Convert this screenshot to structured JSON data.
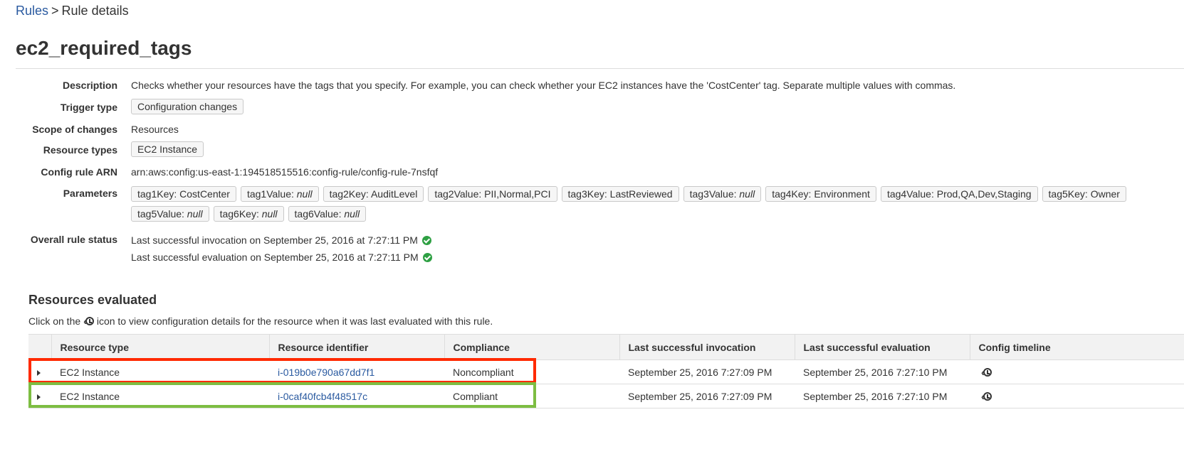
{
  "breadcrumb": {
    "parent": "Rules",
    "separator": ">",
    "current": "Rule details"
  },
  "title": "ec2_required_tags",
  "details": {
    "description": {
      "label": "Description",
      "value": "Checks whether your resources have the tags that you specify. For example, you can check whether your EC2 instances have the 'CostCenter' tag. Separate multiple values with commas."
    },
    "trigger_type": {
      "label": "Trigger type",
      "value": "Configuration changes"
    },
    "scope": {
      "label": "Scope of changes",
      "value": "Resources"
    },
    "resource_types": {
      "label": "Resource types",
      "value": "EC2 Instance"
    },
    "arn": {
      "label": "Config rule ARN",
      "value": "arn:aws:config:us-east-1:194518515516:config-rule/config-rule-7nsfqf"
    },
    "parameters": {
      "label": "Parameters",
      "items": [
        {
          "key": "tag1Key:",
          "value": "CostCenter",
          "null": false
        },
        {
          "key": "tag1Value:",
          "value": "null",
          "null": true
        },
        {
          "key": "tag2Key:",
          "value": "AuditLevel",
          "null": false
        },
        {
          "key": "tag2Value:",
          "value": "PII,Normal,PCI",
          "null": false
        },
        {
          "key": "tag3Key:",
          "value": "LastReviewed",
          "null": false
        },
        {
          "key": "tag3Value:",
          "value": "null",
          "null": true
        },
        {
          "key": "tag4Key:",
          "value": "Environment",
          "null": false
        },
        {
          "key": "tag4Value:",
          "value": "Prod,QA,Dev,Staging",
          "null": false
        },
        {
          "key": "tag5Key:",
          "value": "Owner",
          "null": false
        },
        {
          "key": "tag5Value:",
          "value": "null",
          "null": true
        },
        {
          "key": "tag6Key:",
          "value": "null",
          "null": true
        },
        {
          "key": "tag6Value:",
          "value": "null",
          "null": true
        }
      ]
    },
    "status": {
      "label": "Overall rule status",
      "lines": [
        "Last successful invocation on September 25, 2016 at 7:27:11 PM",
        "Last successful evaluation on September 25, 2016 at 7:27:11 PM"
      ],
      "icon": "check-circle-icon",
      "color": "#2ea043"
    }
  },
  "resources": {
    "title": "Resources evaluated",
    "hint_before": "Click on the",
    "hint_icon": "config-timeline-icon",
    "hint_after": "icon to view configuration details for the resource when it was last evaluated with this rule.",
    "columns": [
      "",
      "Resource type",
      "Resource identifier",
      "Compliance",
      "Last successful invocation",
      "Last successful evaluation",
      "Config timeline"
    ],
    "rows": [
      {
        "type": "EC2 Instance",
        "id": "i-019b0e790a67dd7f1",
        "compliance": "Noncompliant",
        "invocation": "September 25, 2016 7:27:09 PM",
        "evaluation": "September 25, 2016 7:27:10 PM",
        "highlight": "#ff2a00"
      },
      {
        "type": "EC2 Instance",
        "id": "i-0caf40fcb4f48517c",
        "compliance": "Compliant",
        "invocation": "September 25, 2016 7:27:09 PM",
        "evaluation": "September 25, 2016 7:27:10 PM",
        "highlight": "#7dbd42"
      }
    ],
    "colors": {
      "noncompliant": "#d0021b",
      "compliant": "#1d8102",
      "link": "#2a5aa0"
    }
  }
}
